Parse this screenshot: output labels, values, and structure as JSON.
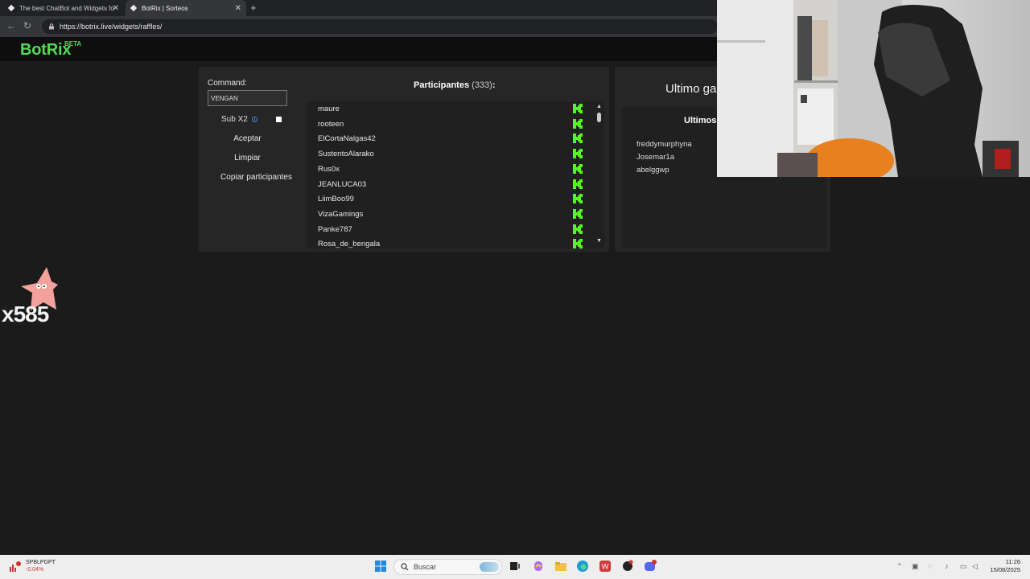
{
  "browser": {
    "tabs": [
      {
        "label": "The best ChatBot and Widgets fo"
      },
      {
        "label": "BotRix | Sorteos"
      }
    ],
    "new_tab_label": "+",
    "url": "https://botrix.live/widgets/raffles/"
  },
  "site": {
    "logo": "BotRix",
    "badge": "BETA"
  },
  "raffle": {
    "command_label": "Command:",
    "command_value": "VENGAN",
    "sub_label": "Sub X2",
    "accept_label": "Aceptar",
    "clear_label": "Limpiar",
    "copy_label": "Copiar participantes",
    "participants_title": "Participantes",
    "participants_count": "(333)",
    "participants_suffix": ":",
    "participants": [
      "maure",
      "rooteen",
      "ElCortaNalgas42",
      "SustentoAlarako",
      "Rus0x",
      "JEANLUCA03",
      "LiimBoo99",
      "VizaGamings",
      "Panke787",
      "Rosa_de_bengala"
    ]
  },
  "winners": {
    "last_title": "Ultimo ga",
    "list_title": "Ultimos",
    "list": [
      "freddymurphyna",
      "Josemar1a",
      "abelggwp"
    ]
  },
  "overlay": {
    "counter": "x585"
  },
  "taskbar": {
    "ticker_name": "SPBLPGPT",
    "ticker_change": "-0.04%",
    "search_placeholder": "Buscar",
    "time": "11:26",
    "date": "15/08/2025"
  },
  "colors": {
    "brand_green": "#55d957",
    "kick_green": "#53fc18",
    "panel_bg": "#262626",
    "list_bg": "#202020"
  },
  "icons": {
    "participant_badge": "kick-icon",
    "info": "info-icon"
  }
}
